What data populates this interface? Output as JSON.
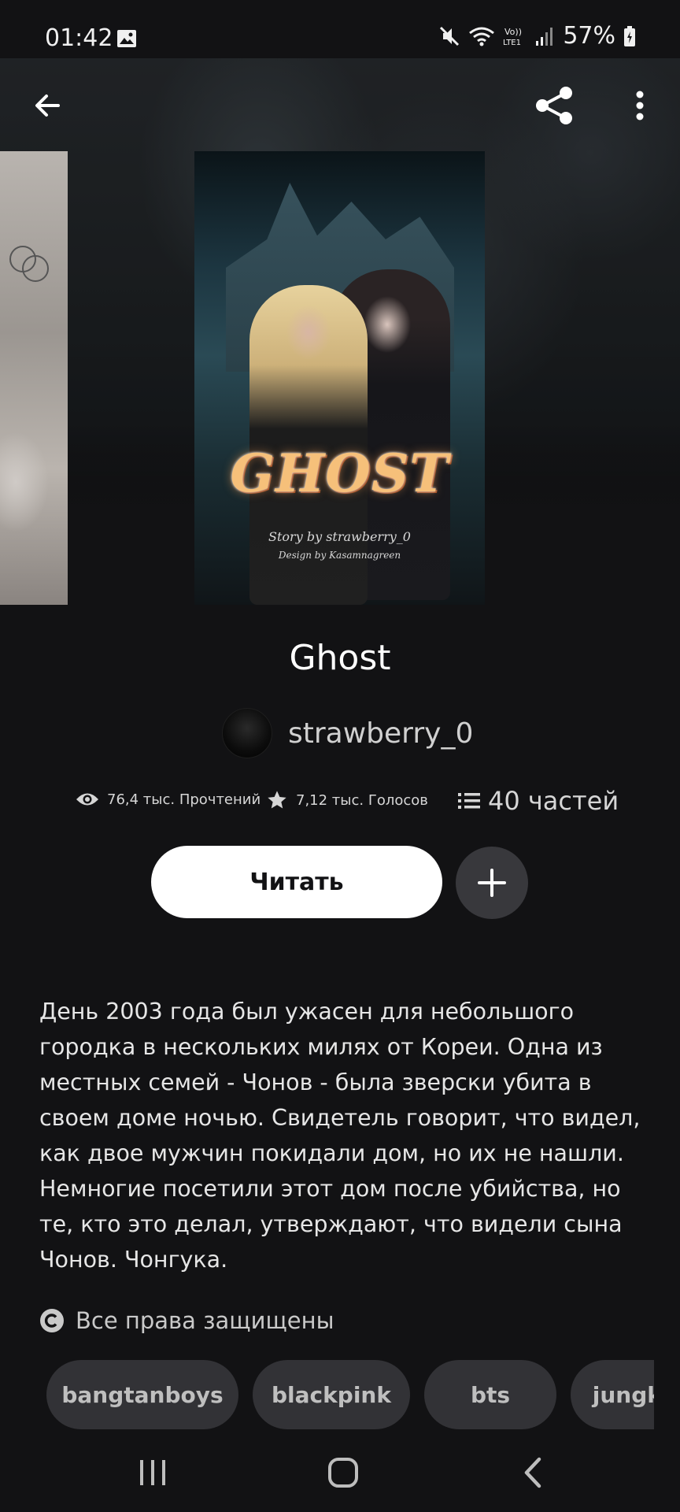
{
  "status_bar": {
    "time": "01:42",
    "battery": "57%",
    "icons": [
      "image-icon",
      "mute-icon",
      "wifi-icon",
      "volte-icon",
      "signal-icon",
      "battery-icon"
    ]
  },
  "header": {
    "back_icon": "arrow-left-icon",
    "share_icon": "share-icon",
    "more_icon": "more-vertical-icon"
  },
  "cover": {
    "title_art": "GHOST",
    "credit_story": "Story by strawberry_0",
    "credit_design": "Design by Kasamnagreen"
  },
  "story": {
    "title": "Ghost",
    "author": "strawberry_0",
    "reads": "76,4 тыс. Прочтений",
    "votes": "7,12 тыс. Голосов",
    "parts": "40 частей"
  },
  "actions": {
    "read_label": "Читать",
    "add_icon": "plus-icon"
  },
  "description": "День 2003 года был ужасен для небольшого городка в нескольких милях от Кореи. Одна из местных семей - Чонов - была зверски убита в своем доме ночью. Свидетель говорит, что видел, как двое мужчин покидали дом, но их не нашли. Немногие посетили этот дом после убийства, но те, кто это делал, утверждают, что видели сына Чонов. Чонгука.",
  "copyright": "Все права защищены",
  "tags": [
    "bangtanboys",
    "blackpink",
    "bts",
    "jungkook"
  ],
  "colors": {
    "background": "#121214",
    "primary_button": "#ffffff",
    "chip": "#323236"
  }
}
